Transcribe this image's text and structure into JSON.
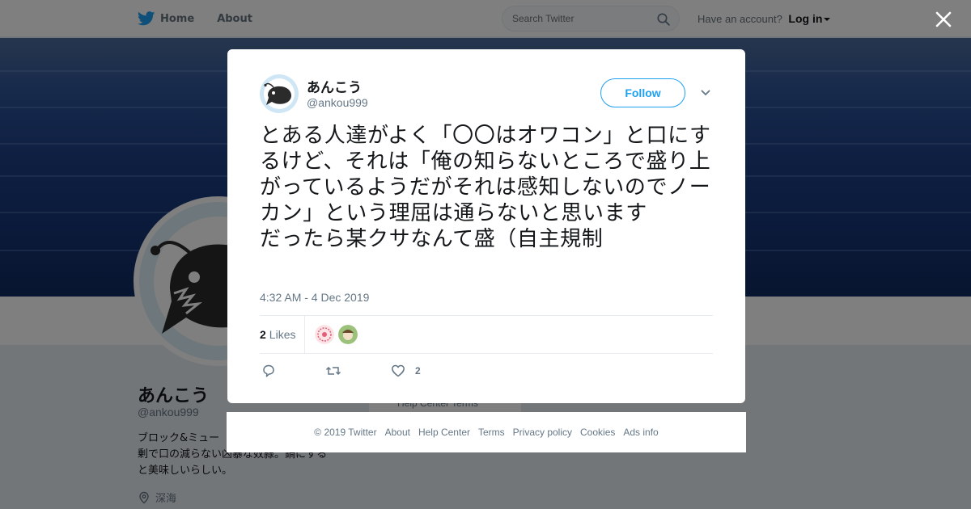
{
  "nav": {
    "home_label": "Home",
    "about_label": "About",
    "search_placeholder": "Search Twitter",
    "account_prompt": "Have an account?",
    "login_label": "Log in"
  },
  "profile": {
    "name": "あんこう",
    "handle": "@ankou999",
    "bio_line1": "ブロック&ミュー",
    "bio_line2": "剰で口の減らない凶暴な奴隷。鍋にする",
    "bio_line3": "と美味しいらしい。",
    "location": "深海",
    "behind_links": "Help Center   Terms"
  },
  "tweet": {
    "author_name": "あんこう",
    "author_handle": "@ankou999",
    "follow_label": "Follow",
    "text": "とある人達がよく「〇〇はオワコン」と口にするけど、それは「俺の知らないところで盛り上がっているようだがそれは感知しないのでノーカン」という理屈は通らないと思います\nだったら某クサなんて盛（自主規制",
    "timestamp": "4:32 AM - 4 Dec 2019",
    "likes_number": "2",
    "likes_label": "Likes",
    "like_action_count": "2"
  },
  "footer": {
    "links": [
      "© 2019 Twitter",
      "About",
      "Help Center",
      "Terms",
      "Privacy policy",
      "Cookies",
      "Ads info"
    ]
  },
  "colors": {
    "accent": "#1da1f2",
    "text": "#14171a",
    "muted": "#657786"
  },
  "icons": [
    "twitter-bird-icon",
    "search-icon",
    "close-icon",
    "chevron-down-icon",
    "reply-icon",
    "retweet-icon",
    "heart-icon",
    "location-icon"
  ]
}
